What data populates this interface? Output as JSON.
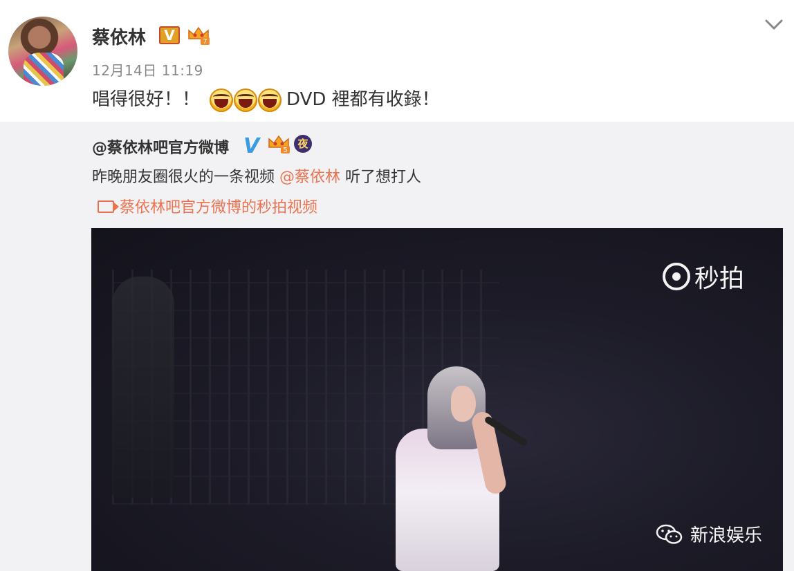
{
  "post": {
    "author": "蔡依林",
    "badge_v": "V",
    "vip_level": "7",
    "timestamp": "12月14日 11:19",
    "text_before": "唱得很好！！",
    "text_after": "DVD 裡都有收錄！"
  },
  "repost": {
    "author": "@蔡依林吧官方微博",
    "badge_v": "V",
    "vip_level": "5",
    "night_badge": "夜",
    "text": "昨晚朋友圈很火的一条视频 ",
    "mention": "@蔡依林",
    "text_after": " 听了想打人",
    "video_link": "蔡依林吧官方微博的秒拍视频"
  },
  "video": {
    "brand": "秒拍",
    "watermark": "新浪娱乐"
  },
  "colors": {
    "accent": "#eb7350",
    "verified_blue": "#3a9be0",
    "repost_bg": "#f2f2f5"
  }
}
